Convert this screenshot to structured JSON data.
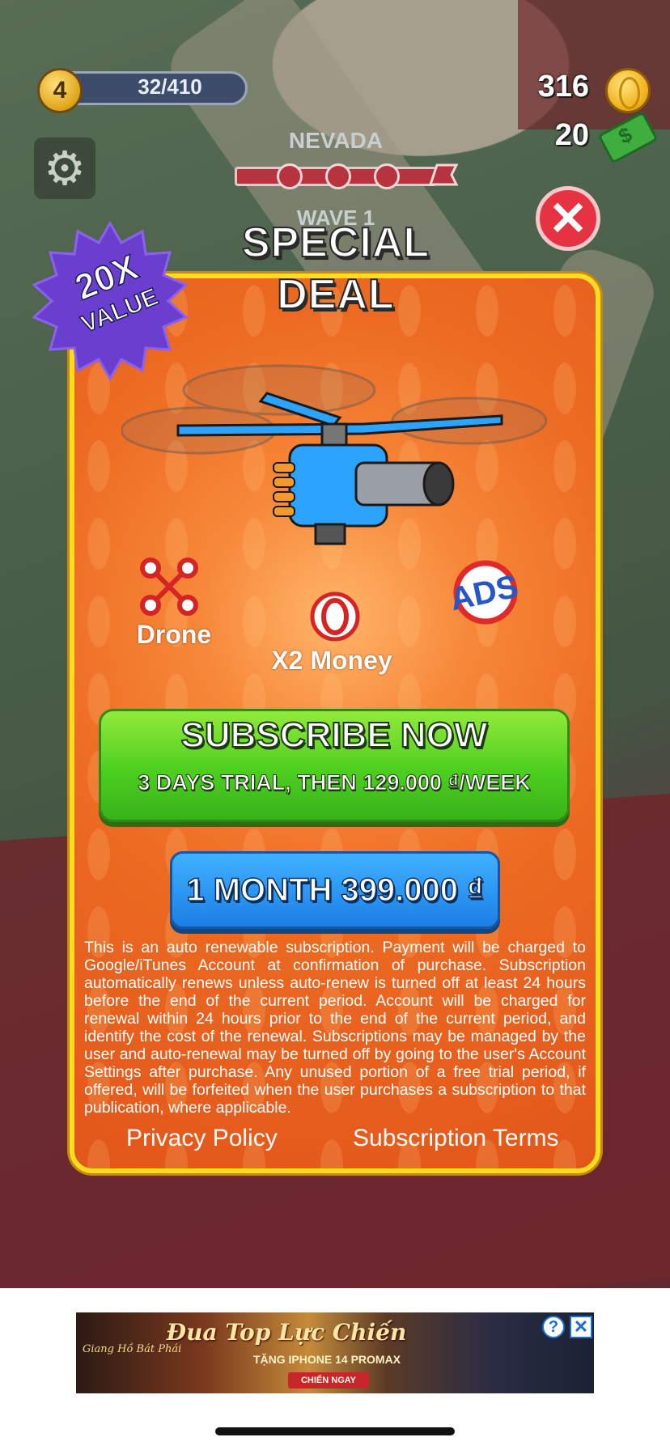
{
  "hud": {
    "level": "4",
    "xp": "32/410",
    "coins": "316",
    "cash": "20",
    "region": "NEVADA",
    "wave": "WAVE 1"
  },
  "offer": {
    "title_line1": "SPECIAL",
    "title_line2": "DEAL",
    "badge_main": "20X",
    "badge_sub": "VALUE",
    "perks": [
      "Drone",
      "X2 Money"
    ],
    "ads_icon_text": "ADS",
    "subscribe_label": "SUBSCRIBE NOW",
    "subscribe_detail": "3 DAYS TRIAL, THEN 129.000 ₫/WEEK",
    "month_label": "1 MONTH 399.000 ₫",
    "legal": "This is an auto renewable subscription. Payment will be charged to Google/iTunes Account at confirmation of purchase. Subscription automatically renews unless auto-renew is turned off at least 24 hours before the end of the current period. Account will be charged for renewal within 24 hours prior to the end of the current period, and identify the cost of the renewal. Subscriptions may be managed by the user and auto-renewal may be turned off by going to the user's Account Settings after purchase. Any unused portion of a free trial period, if offered, will be forfeited when the user purchases a subscription to that publication, where applicable.",
    "privacy_link": "Privacy Policy",
    "terms_link": "Subscription Terms"
  },
  "ad": {
    "headline": "Đua Top Lực Chiến",
    "subline": "TẶNG IPHONE 14 PROMAX",
    "cta": "CHIẾN NGAY",
    "brand": "Giang Hồ Bát Phái",
    "info_icon": "?",
    "close_icon": "✕"
  },
  "colors": {
    "modal_orange": "#ec6a22",
    "modal_border": "#ffdd1e",
    "subscribe_green": "#4dcf1f",
    "month_blue": "#1c7fe6",
    "close_red": "#e63342",
    "badge_purple": "#6a3fd0"
  }
}
